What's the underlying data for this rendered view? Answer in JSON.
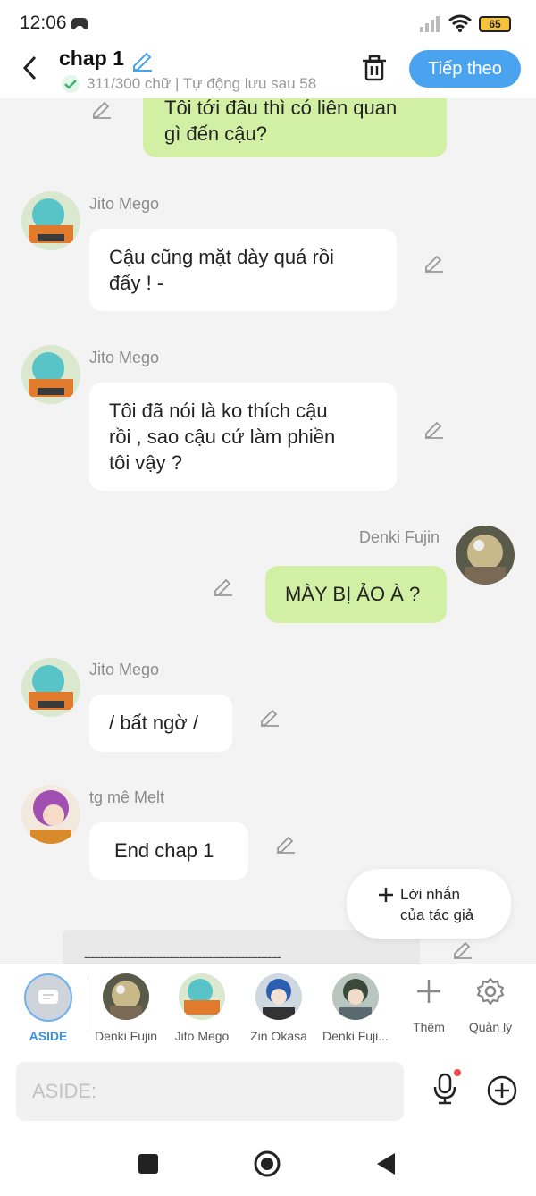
{
  "status_bar": {
    "time": "12:06",
    "battery": "65"
  },
  "header": {
    "title": "chap 1",
    "subtitle": "311/300 chữ | Tự động lưu sau 58",
    "next_label": "Tiếp theo"
  },
  "messages": [
    {
      "side": "right",
      "text_line1": "Tôi tới đâu thì có liên quan",
      "text_line2": "gì đến cậu?"
    },
    {
      "side": "left",
      "name": "Jito Mego",
      "text_line1": "Cậu cũng mặt dày quá rồi",
      "text_line2": "đấy ! -"
    },
    {
      "side": "left",
      "name": "Jito Mego",
      "text_line1": "Tôi đã nói là ko thích cậu",
      "text_line2": "rồi , sao cậu cứ làm phiền",
      "text_line3": "tôi vậy ?"
    },
    {
      "side": "right",
      "name": "Denki Fujin",
      "text_line1": "MÀY BỊ ẢO À ?"
    },
    {
      "side": "left",
      "name": "Jito Mego",
      "text_line1": "/ bất ngờ /"
    },
    {
      "side": "left",
      "name": "tg mê Melt",
      "text_line1": "End chap 1"
    }
  ],
  "author_note": {
    "line1": "Lời nhắn",
    "line2": "của tác giả"
  },
  "separator_text": "------------------------------------------------------------",
  "characters": [
    {
      "label": "ASIDE"
    },
    {
      "label": "Denki Fujin"
    },
    {
      "label": "Jito Mego"
    },
    {
      "label": "Zin Okasa"
    },
    {
      "label": "Denki Fuji..."
    },
    {
      "label": "Thêm"
    },
    {
      "label": "Quản lý"
    }
  ],
  "input": {
    "placeholder": "ASIDE:"
  },
  "colors": {
    "accent": "#4aa3ef",
    "bubble_green": "#d2f0a4",
    "active_tab": "#3a8fe0"
  },
  "icons": [
    "back-arrow-icon",
    "edit-pencil-icon",
    "trash-icon",
    "check-icon",
    "mic-icon",
    "add-circle-icon",
    "plus-icon",
    "gear-icon",
    "square-icon",
    "home-circle-icon",
    "back-triangle-icon"
  ]
}
